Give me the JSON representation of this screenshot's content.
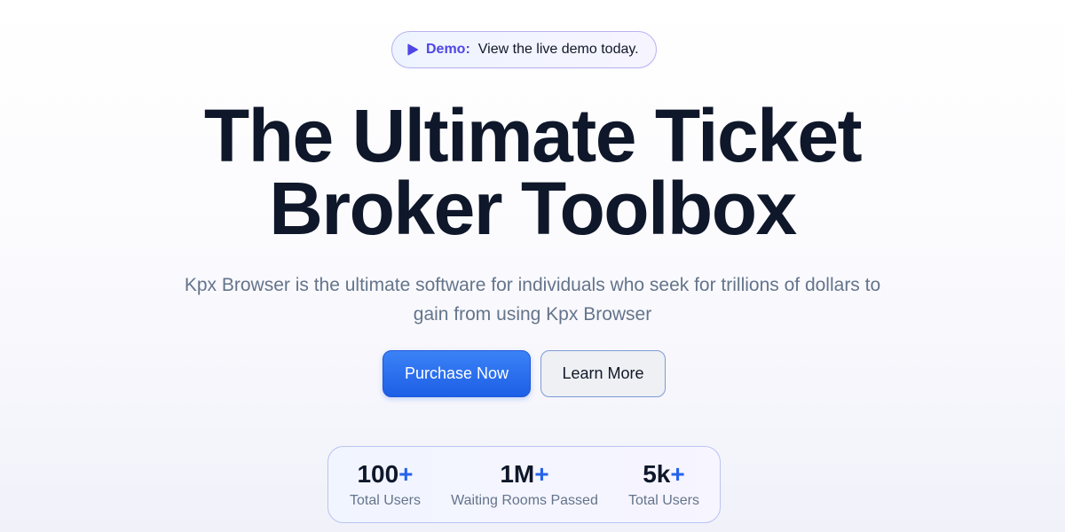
{
  "demo_banner": {
    "label": "Demo:",
    "text": "View the live demo today."
  },
  "hero": {
    "headline_line1": "The Ultimate Ticket",
    "headline_line2": "Broker Toolbox",
    "subtitle": "Kpx Browser is the ultimate software for individuals who seek for trillions of dollars to gain from using Kpx Browser"
  },
  "actions": {
    "primary_label": "Purchase Now",
    "secondary_label": "Learn More"
  },
  "stats": [
    {
      "value": "100",
      "suffix": "+",
      "label": "Total Users"
    },
    {
      "value": "1M",
      "suffix": "+",
      "label": "Waiting Rooms Passed"
    },
    {
      "value": "5k",
      "suffix": "+",
      "label": "Total Users"
    }
  ],
  "colors": {
    "accent": "#2563eb",
    "demo_label": "#4f46e5",
    "headline": "#0f172a",
    "muted_text": "#64748b"
  },
  "icons": {
    "demo": "play-icon"
  }
}
